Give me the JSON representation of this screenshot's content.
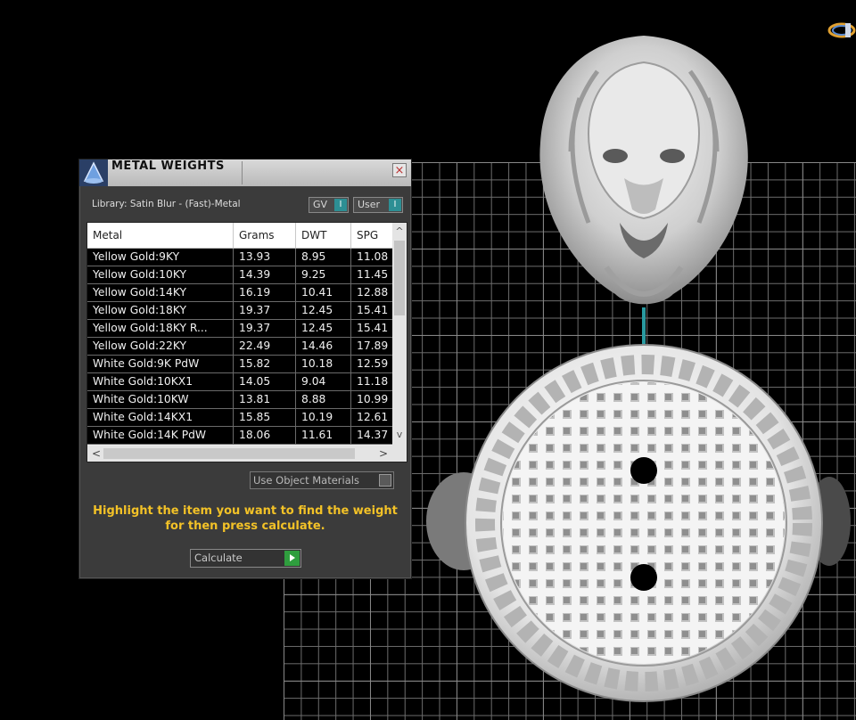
{
  "dialog": {
    "title": "METAL WEIGHTS",
    "close_glyph": "×",
    "library_label": "Library: Satin Blur - (Fast)-Metal",
    "gv_label": "GV",
    "user_label": "User",
    "toggle_glyph": "I",
    "use_object_materials": "Use Object Materials",
    "hint_line1": "Highlight the item you want to find the weight",
    "hint_line2": "for then press calculate.",
    "calculate_label": "Calculate"
  },
  "table": {
    "columns": [
      "Metal",
      "Grams",
      "DWT",
      "SPG"
    ],
    "rows": [
      [
        "Yellow Gold:9KY",
        "13.93",
        "8.95",
        "11.08"
      ],
      [
        "Yellow Gold:10KY",
        "14.39",
        "9.25",
        "11.45"
      ],
      [
        "Yellow Gold:14KY",
        "16.19",
        "10.41",
        "12.88"
      ],
      [
        "Yellow Gold:18KY",
        "19.37",
        "12.45",
        "15.41"
      ],
      [
        "Yellow Gold:18KY R...",
        "19.37",
        "12.45",
        "15.41"
      ],
      [
        "Yellow Gold:22KY",
        "22.49",
        "14.46",
        "17.89"
      ],
      [
        "White Gold:9K PdW",
        "15.82",
        "10.18",
        "12.59"
      ],
      [
        "White Gold:10KX1",
        "14.05",
        "9.04",
        "11.18"
      ],
      [
        "White Gold:10KW",
        "13.81",
        "8.88",
        "10.99"
      ],
      [
        "White Gold:14KX1",
        "15.85",
        "10.19",
        "12.61"
      ],
      [
        "White Gold:14K PdW",
        "18.06",
        "11.61",
        "14.37"
      ]
    ],
    "scroll_up": "^",
    "scroll_down": "v",
    "scroll_left": "<",
    "scroll_right": ">"
  },
  "icons": {
    "logo": "cone-logo-icon",
    "gizmo": "orientation-gizmo-icon"
  },
  "colors": {
    "hint": "#f3c227",
    "toggle": "#2d8f94",
    "calculate_go": "#2f9e3e"
  }
}
